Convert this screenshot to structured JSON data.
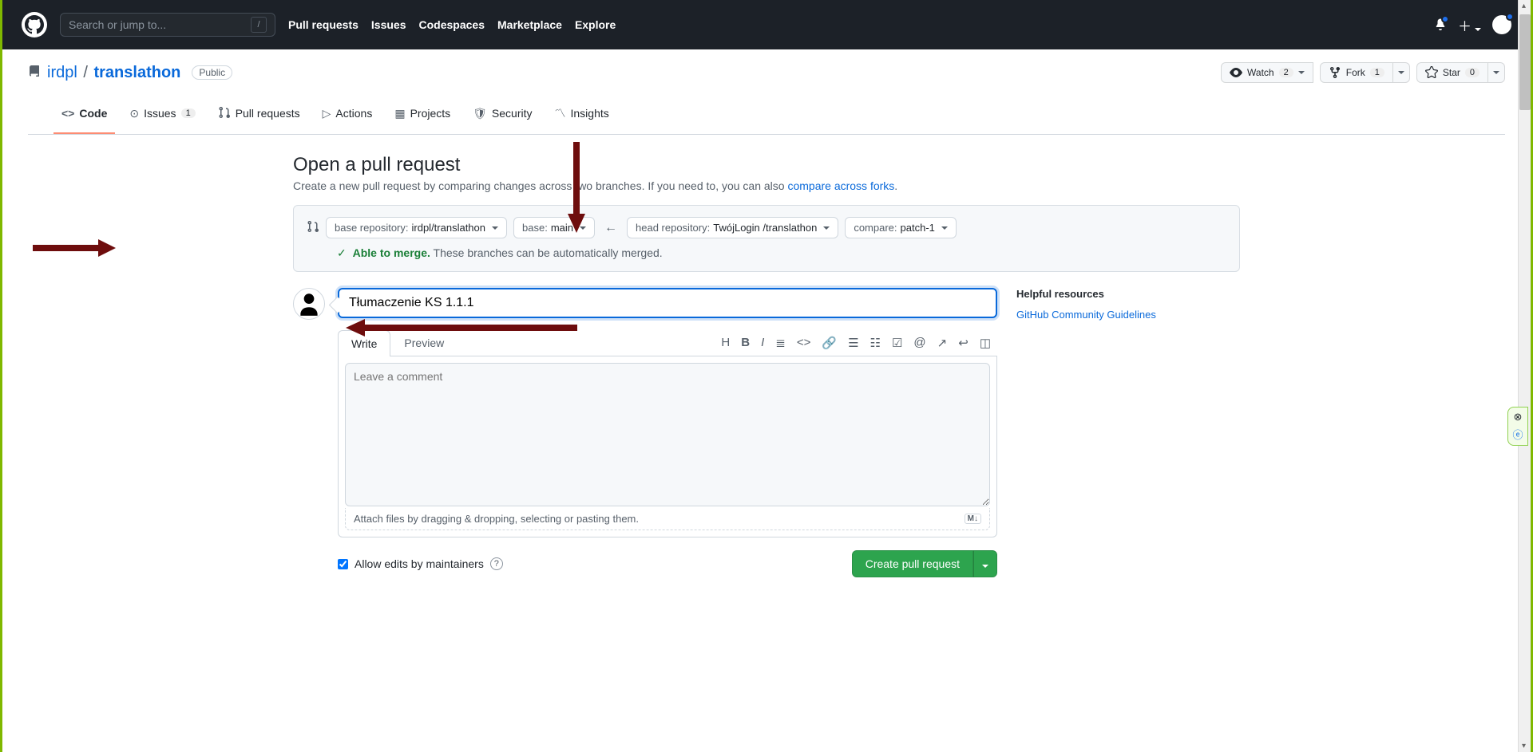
{
  "header": {
    "search_placeholder": "Search or jump to...",
    "nav": [
      "Pull requests",
      "Issues",
      "Codespaces",
      "Marketplace",
      "Explore"
    ]
  },
  "repo": {
    "owner": "irdpl",
    "name": "translathon",
    "visibility": "Public",
    "watch_label": "Watch",
    "watch_count": "2",
    "fork_label": "Fork",
    "fork_count": "1",
    "star_label": "Star",
    "star_count": "0"
  },
  "repoNav": {
    "code": "Code",
    "issues": "Issues",
    "issues_count": "1",
    "pulls": "Pull requests",
    "actions": "Actions",
    "projects": "Projects",
    "security": "Security",
    "insights": "Insights"
  },
  "page": {
    "title": "Open a pull request",
    "subtitle_a": "Create a new pull request by comparing changes across two branches. If you need to, you can also ",
    "subtitle_link": "compare across forks",
    "subtitle_b": "."
  },
  "compare": {
    "base_repo_lbl": "base repository:",
    "base_repo_val": "irdpl/translathon",
    "base_lbl": "base:",
    "base_val": "main",
    "head_repo_lbl": "head repository:",
    "head_repo_val": "TwójLogin /translathon",
    "compare_lbl": "compare:",
    "compare_val": "patch-1",
    "merge_ok": "Able to merge.",
    "merge_rest": " These branches can be automatically merged."
  },
  "form": {
    "title_value": "Tłumaczenie KS 1.1.1",
    "tab_write": "Write",
    "tab_preview": "Preview",
    "comment_placeholder": "Leave a comment",
    "attach_hint": "Attach files by dragging & dropping, selecting or pasting them.",
    "allow_edits": "Allow edits by maintainers",
    "create_btn": "Create pull request"
  },
  "sidebar": {
    "heading": "Helpful resources",
    "link": "GitHub Community Guidelines"
  }
}
